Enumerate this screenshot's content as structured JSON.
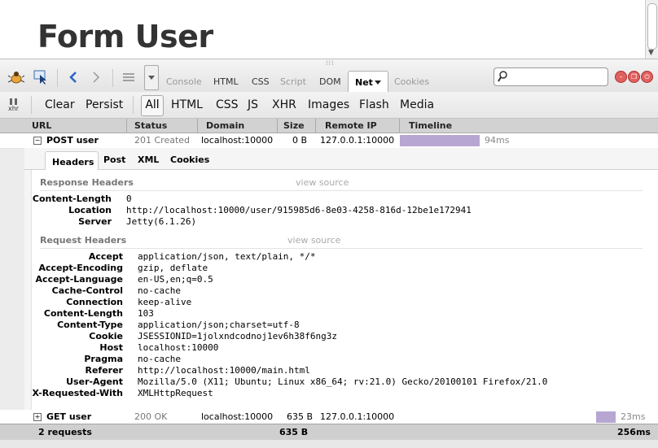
{
  "page": {
    "title": "Form User"
  },
  "toolbar": {
    "tabs": [
      "Console",
      "HTML",
      "CSS",
      "Script",
      "DOM",
      "Net",
      "Cookies"
    ],
    "active_tab": "Net",
    "search_value": ""
  },
  "filters": {
    "clear": "Clear",
    "persist": "Persist",
    "types": [
      "All",
      "HTML",
      "CSS",
      "JS",
      "XHR",
      "Images",
      "Flash",
      "Media"
    ],
    "active": "All",
    "xhr_label": "xhr"
  },
  "columns": [
    "URL",
    "Status",
    "Domain",
    "Size",
    "Remote IP",
    "Timeline"
  ],
  "requests": [
    {
      "method_url": "POST user",
      "status": "201 Created",
      "domain": "localhost:10000",
      "size": "0 B",
      "remote_ip": "127.0.0.1:10000",
      "time": "94ms",
      "expanded": true
    },
    {
      "method_url": "GET user",
      "status": "200 OK",
      "domain": "localhost:10000",
      "size": "635 B",
      "remote_ip": "127.0.0.1:10000",
      "time": "23ms",
      "expanded": false
    }
  ],
  "detail": {
    "tabs": [
      "Headers",
      "Post",
      "XML",
      "Cookies"
    ],
    "active_tab": "Headers",
    "response_title": "Response Headers",
    "request_title": "Request Headers",
    "view_source": "view source",
    "response_headers": [
      {
        "name": "Content-Length",
        "value": "0"
      },
      {
        "name": "Location",
        "value": "http://localhost:10000/user/915985d6-8e03-4258-816d-12be1e172941"
      },
      {
        "name": "Server",
        "value": "Jetty(6.1.26)"
      }
    ],
    "request_headers": [
      {
        "name": "Accept",
        "value": "application/json, text/plain, */*"
      },
      {
        "name": "Accept-Encoding",
        "value": "gzip, deflate"
      },
      {
        "name": "Accept-Language",
        "value": "en-US,en;q=0.5"
      },
      {
        "name": "Cache-Control",
        "value": "no-cache"
      },
      {
        "name": "Connection",
        "value": "keep-alive"
      },
      {
        "name": "Content-Length",
        "value": "103"
      },
      {
        "name": "Content-Type",
        "value": "application/json;charset=utf-8"
      },
      {
        "name": "Cookie",
        "value": "JSESSIONID=1jolxndcodnoj1ev6h38f6ng3z"
      },
      {
        "name": "Host",
        "value": "localhost:10000"
      },
      {
        "name": "Pragma",
        "value": "no-cache"
      },
      {
        "name": "Referer",
        "value": "http://localhost:10000/main.html"
      },
      {
        "name": "User-Agent",
        "value": "Mozilla/5.0 (X11; Ubuntu; Linux x86_64; rv:21.0) Gecko/20100101 Firefox/21.0"
      },
      {
        "name": "X-Requested-With",
        "value": "XMLHttpRequest"
      }
    ]
  },
  "summary": {
    "count": "2 requests",
    "size": "635 B",
    "time": "256ms"
  },
  "colors": {
    "timeline_bar": "#b7a6d2",
    "header_bg": "#d2d2d2"
  }
}
